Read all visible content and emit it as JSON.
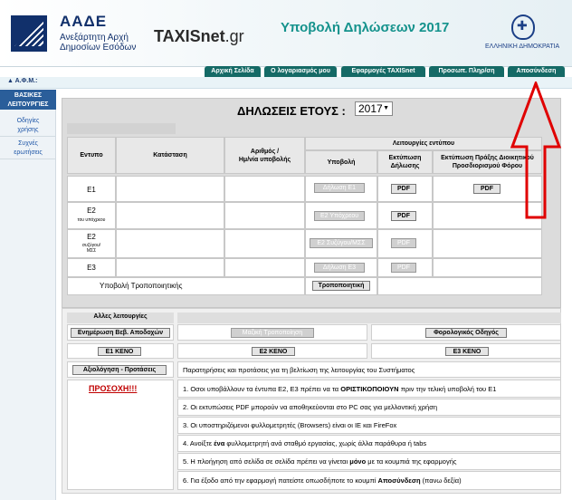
{
  "header": {
    "org_abbr": "ΑΑΔΕ",
    "org_line1": "Ανεξάρτητη Αρχή",
    "org_line2": "Δημοσίων Εσόδων",
    "taxisnet_main": "TAXISnet",
    "taxisnet_suffix": ".gr",
    "title": "Υποβολή Δηλώσεων 2017",
    "republic": "ΕΛΛΗΝΙΚΗ ΔΗΜΟΚΡΑΤΙΑ"
  },
  "nav": {
    "items": [
      "Αρχική Σελίδα",
      "Ο λογαριασμός μου",
      "Εφαρμογές TAXISnet",
      "Προσωπ. Πληρ/ση",
      "Αποσύνδεση"
    ]
  },
  "afm_label": "Α.Φ.Μ.:",
  "sidebar": {
    "heading_line1": "ΒΑΣΙΚΕΣ",
    "heading_line2": "ΛΕΙΤΟΥΡΓΙΕΣ",
    "items": [
      {
        "line1": "Οδηγίες",
        "line2": "χρήσης"
      },
      {
        "line1": "Συχνές",
        "line2": "ερωτήσεις"
      }
    ]
  },
  "declarations": {
    "heading": "ΔΗΛΩΣΕΙΣ ΕΤΟΥΣ :",
    "year": "2017",
    "functions_heading": "Λειτουργίες εντύπου",
    "columns": {
      "form": "Εντυπο",
      "status": "Κατάσταση",
      "number_line1": "Αριθμός /",
      "number_line2": "Ημ/νία υποβολής",
      "submit": "Υποβολή",
      "print_line1": "Εκτύπωση",
      "print_line2": "Δήλωσης",
      "print_act_line1": "Εκτύπωση Πράξης Διοικητικού",
      "print_act_line2": "Προσδιορισμού Φόρου"
    },
    "rows": [
      {
        "code": "E1",
        "sub": "",
        "submit": "Δήλωση Ε1",
        "pdf": "PDF",
        "act_pdf": "PDF"
      },
      {
        "code": "E2",
        "sub": "του υπόχρεου",
        "submit": "Ε2 Υπόχρεου",
        "pdf": "PDF",
        "act_pdf": ""
      },
      {
        "code": "E2",
        "sub": "συζύγου/ ΜΣΣ",
        "submit": "Ε2 Συζύγου/ΜΣΣ",
        "pdf": "PDF",
        "act_pdf": ""
      },
      {
        "code": "E3",
        "sub": "",
        "submit": "Δήλωση Ε3",
        "pdf": "PDF",
        "act_pdf": ""
      }
    ],
    "amend_label": "Υποβολή Τροποποιητικής",
    "amend_button": "Τροποποιητική"
  },
  "other": {
    "heading": "Αλλες λειτουργίες",
    "update_button": "Ενημέρωση Βεβ. Αποδοχών",
    "upload_button": "Μαζική Τροποποίηση",
    "tax_guide_button": "Φορολογικός Οδηγός",
    "e1_blank": "Ε1 ΚΕΝΟ",
    "e2_blank": "Ε2 ΚΕΝΟ",
    "e3_blank": "Ε3 ΚΕΝΟ",
    "feedback_button": "Αξιολόγηση - Προτάσεις",
    "feedback_text": "Παρατηρήσεις και προτάσεις για τη βελτίωση της λειτουργίας του Συστήματος",
    "attention": "ΠΡΟΣΟΧΗ!!!",
    "notes": [
      {
        "pre": "1. Οσοι υποβάλλουν τα έντυπα Ε2, Ε3 πρέπει να τα ",
        "bold": "ΟΡΙΣΤΙΚΟΠΟΙΟΥΝ",
        "post": " πριν την τελική υποβολή του Ε1"
      },
      {
        "pre": "2. Οι εκτυπώσεις PDF μπορούν να αποθηκεύονται στο PC σας για μελλοντική χρήση",
        "bold": "",
        "post": ""
      },
      {
        "pre": "3. Οι υποστηριζόμενοι φυλλομετρητές (Browsers) είναι οι IE και FireFox",
        "bold": "",
        "post": ""
      },
      {
        "pre": "4. Ανοίξτε ",
        "bold": "ένα",
        "post": " φυλλομετρητή ανά σταθμό εργασίας, χωρίς άλλα παράθυρα ή tabs"
      },
      {
        "pre": "5. Η πλοήγηση από σελίδα σε σελίδα πρέπει να γίνεται ",
        "bold": "μόνο",
        "post": " με τα κουμπιά της εφαρμογής"
      },
      {
        "pre": "6. Για έξοδο από την εφαρμογή πατείστε οπωσδήποτε το κουμπί ",
        "bold": "Αποσύνδεση",
        "post": " (πανω δεξία)"
      }
    ]
  },
  "colors": {
    "nav_bg": "#156a66",
    "title_color": "#14928c",
    "brand_navy": "#11306b",
    "attention_red": "#c00000",
    "annotation_arrow": "#e00000"
  }
}
